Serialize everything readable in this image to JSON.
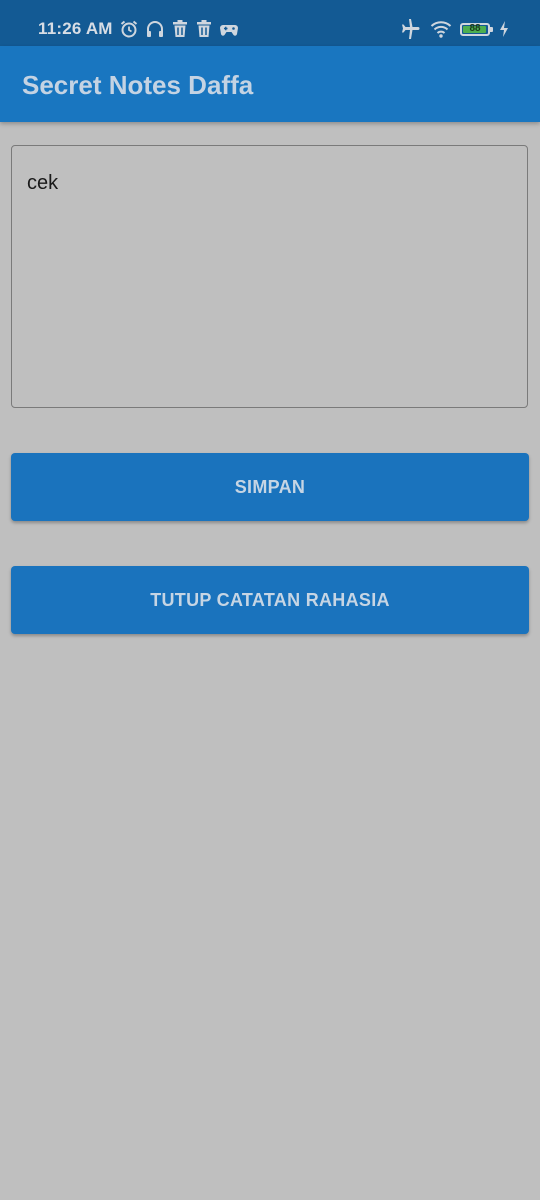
{
  "status_bar": {
    "time": "11:26 AM",
    "left_icons": [
      "alarm-icon",
      "headphones-icon",
      "trash-icon",
      "trash-icon",
      "game-controller-icon"
    ],
    "right_icons": [
      "airplane-mode-icon",
      "wifi-icon",
      "battery-icon",
      "charging-bolt-icon"
    ],
    "battery_level": "88"
  },
  "app_bar": {
    "title": "Secret Notes Daffa",
    "color": "#1976c0"
  },
  "note": {
    "value": "cek"
  },
  "buttons": {
    "save_label": "SIMPAN",
    "close_label": "TUTUP CATATAN RAHASIA",
    "color": "#1a73bd"
  },
  "colors": {
    "background": "#bfbfbf",
    "status_bar": "#135a94"
  }
}
